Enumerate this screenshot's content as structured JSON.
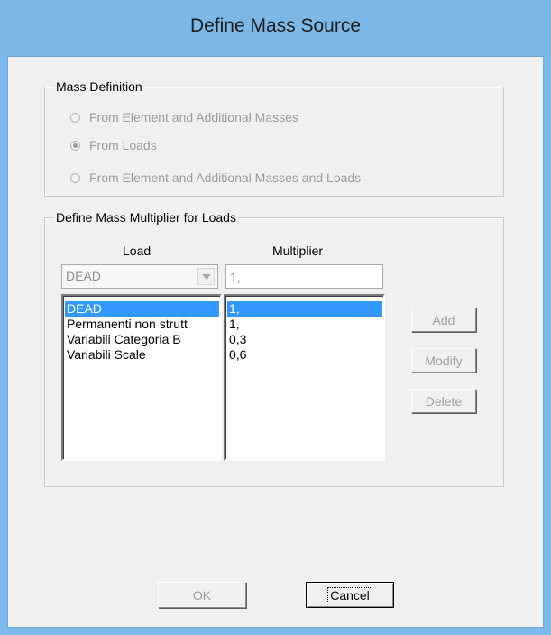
{
  "window": {
    "title": "Define Mass Source"
  },
  "mass_definition": {
    "legend": "Mass Definition",
    "options": [
      {
        "label": "From Element and Additional Masses",
        "checked": false
      },
      {
        "label": "From Loads",
        "checked": true
      },
      {
        "label": "From Element and Additional Masses and Loads",
        "checked": false
      }
    ]
  },
  "multiplier_group": {
    "legend": "Define Mass Multiplier for Loads",
    "load_header": "Load",
    "multiplier_header": "Multiplier",
    "load_combo_value": "DEAD",
    "multiplier_input_value": "1,",
    "loads": [
      "DEAD",
      "Permanenti non strutt",
      "Variabili Categoria B",
      "Variabili Scale"
    ],
    "multipliers": [
      "1,",
      "1,",
      "0,3",
      "0,6"
    ],
    "selected_index": 0
  },
  "buttons": {
    "add": "Add",
    "modify": "Modify",
    "delete": "Delete",
    "ok": "OK",
    "cancel": "Cancel"
  }
}
